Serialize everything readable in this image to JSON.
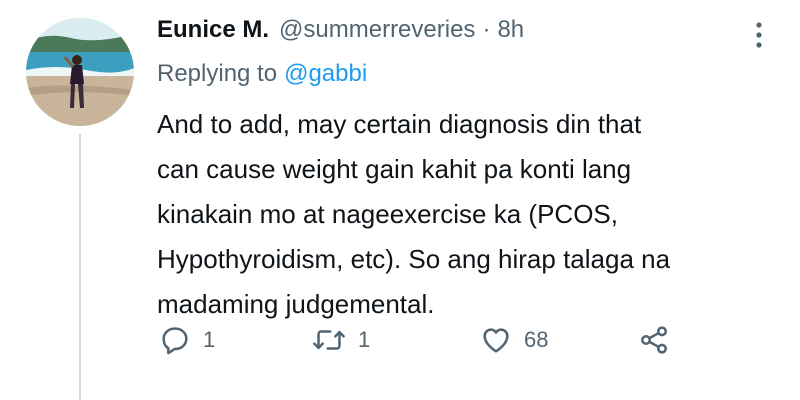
{
  "tweet": {
    "author_name": "Eunice M.",
    "author_handle": "@summerreveries",
    "separator": "·",
    "time": "8h",
    "replying_prefix": "Replying to",
    "replying_to": "@gabbi",
    "text_lines": [
      "And to add, may certain diagnosis din that",
      "can cause weight gain kahit pa konti lang",
      "kinakain mo at nageexercise ka (PCOS,",
      "Hypothyroidism, etc). So ang hirap talaga na",
      "madaming judgemental."
    ]
  },
  "actions": {
    "reply_count": "1",
    "retweet_count": "1",
    "like_count": "68"
  },
  "icons": {
    "reply": "reply-icon",
    "retweet": "retweet-icon",
    "like": "heart-icon",
    "share": "share-icon",
    "more": "more-vertical-icon"
  },
  "colors": {
    "text": "#0f1419",
    "secondary": "#536471",
    "link": "#1d9bf0",
    "thread_line": "#cfd9de"
  }
}
